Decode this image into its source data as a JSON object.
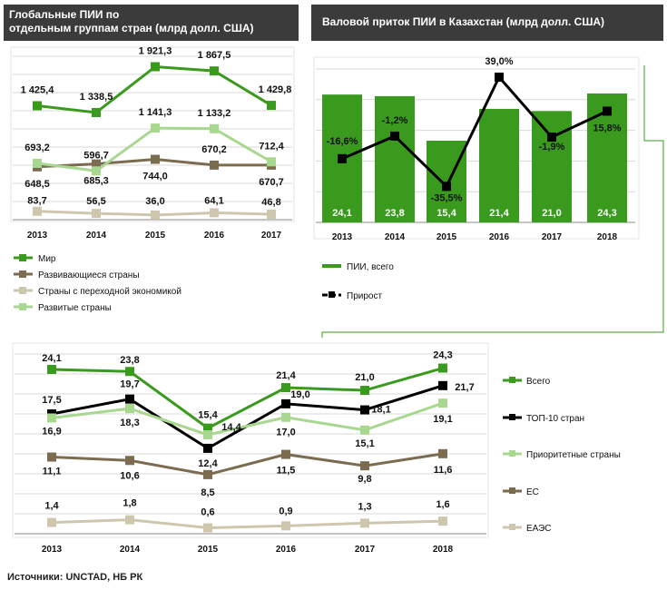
{
  "header_left": {
    "line1": "Глобальные ПИИ по",
    "line2": "отдельным группам стран (млрд долл. США)"
  },
  "header_right": "Валовой приток ПИИ в Казахстан (млрд долл. США)",
  "source": "Источники:  UNCTAD,  НБ РК",
  "colors": {
    "green": "#3a9a1e",
    "dark": "#000000",
    "lightgreen": "#a8d890",
    "brown": "#7b6b4f",
    "beige": "#cfc6ae",
    "bar": "#3a9a1e"
  },
  "chart_data": [
    {
      "type": "line",
      "categories": [
        "2013",
        "2014",
        "2015",
        "2016",
        "2017"
      ],
      "ylim": [
        0,
        2200
      ],
      "series": [
        {
          "name": "Мир",
          "color": "#3a9a1e",
          "values": [
            1425.4,
            1338.5,
            1921.3,
            1867.5,
            1429.8
          ],
          "labels": [
            "1 425,4",
            "1 338,5",
            "1 921,3",
            "1 867,5",
            "1 429,8"
          ]
        },
        {
          "name": "Развивающиеся страны",
          "color": "#7b6b4f",
          "values": [
            648.5,
            685.3,
            744.0,
            670.2,
            670.7
          ],
          "labels": [
            "648,5",
            "685,3",
            "744,0",
            "670,2",
            "670,7"
          ]
        },
        {
          "name": "Страны с переходной экономикой",
          "color": "#cfc6ae",
          "values": [
            83.7,
            56.5,
            36.0,
            64.1,
            46.8
          ],
          "labels": [
            "83,7",
            "56,5",
            "36,0",
            "64,1",
            "46,8"
          ]
        },
        {
          "name": "Развитые страны",
          "color": "#a8d890",
          "values": [
            693.2,
            596.7,
            1141.3,
            1133.2,
            712.4
          ],
          "labels": [
            "693,2",
            "596,7",
            "1 141,3",
            "1 133,2",
            "712,4"
          ]
        }
      ]
    },
    {
      "type": "bar",
      "categories": [
        "2013",
        "2014",
        "2015",
        "2016",
        "2017",
        "2018"
      ],
      "series": [
        {
          "name": "ПИИ, всего",
          "color": "#3a9a1e",
          "values": [
            24.1,
            23.8,
            15.4,
            21.4,
            21.0,
            24.3
          ],
          "labels": [
            "24,1",
            "23,8",
            "15,4",
            "21,4",
            "21,0",
            "24,3"
          ]
        },
        {
          "name": "Прирост",
          "color": "#000000",
          "values": [
            -16.6,
            -1.2,
            -35.5,
            39.0,
            -1.9,
            15.8
          ],
          "labels": [
            "",
            "-16,6%",
            "-1,2%",
            "-35,5%",
            "39,0%",
            "-1,9%",
            "15,8%"
          ]
        }
      ],
      "growth_labels": [
        "-16,6%",
        "-1,2%",
        "-35,5%",
        "39,0%",
        "-1,9%",
        "15,8%"
      ]
    },
    {
      "type": "line",
      "categories": [
        "2013",
        "2014",
        "2015",
        "2016",
        "2017",
        "2018"
      ],
      "ylim": [
        0,
        25
      ],
      "series": [
        {
          "name": "Всего",
          "color": "#3a9a1e",
          "values": [
            24.1,
            23.8,
            15.4,
            21.4,
            21.0,
            24.3
          ],
          "labels": [
            "24,1",
            "23,8",
            "15,4",
            "21,4",
            "21,0",
            "24,3"
          ]
        },
        {
          "name": "ТОП-10 стран",
          "color": "#000000",
          "values": [
            17.5,
            19.7,
            12.4,
            19.0,
            18.1,
            21.7
          ],
          "labels": [
            "17,5",
            "19,7",
            "12,4",
            "19,0",
            "18,1",
            "21,7"
          ]
        },
        {
          "name": "Приоритетные страны",
          "color": "#a8d890",
          "values": [
            16.9,
            18.3,
            14.4,
            17.0,
            15.1,
            19.1
          ],
          "labels": [
            "16,9",
            "18,3",
            "14,4",
            "17,0",
            "15,1",
            "19,1"
          ]
        },
        {
          "name": "ЕС",
          "color": "#7b6b4f",
          "values": [
            11.1,
            10.6,
            8.5,
            11.5,
            9.8,
            11.6
          ],
          "labels": [
            "11,1",
            "10,6",
            "8,5",
            "11,5",
            "9,8",
            "11,6"
          ]
        },
        {
          "name": "ЕАЭС",
          "color": "#cfc6ae",
          "values": [
            1.4,
            1.8,
            0.6,
            0.9,
            1.3,
            1.6
          ],
          "labels": [
            "1,4",
            "1,8",
            "0,6",
            "0,9",
            "1,3",
            "1,6"
          ]
        }
      ]
    }
  ]
}
